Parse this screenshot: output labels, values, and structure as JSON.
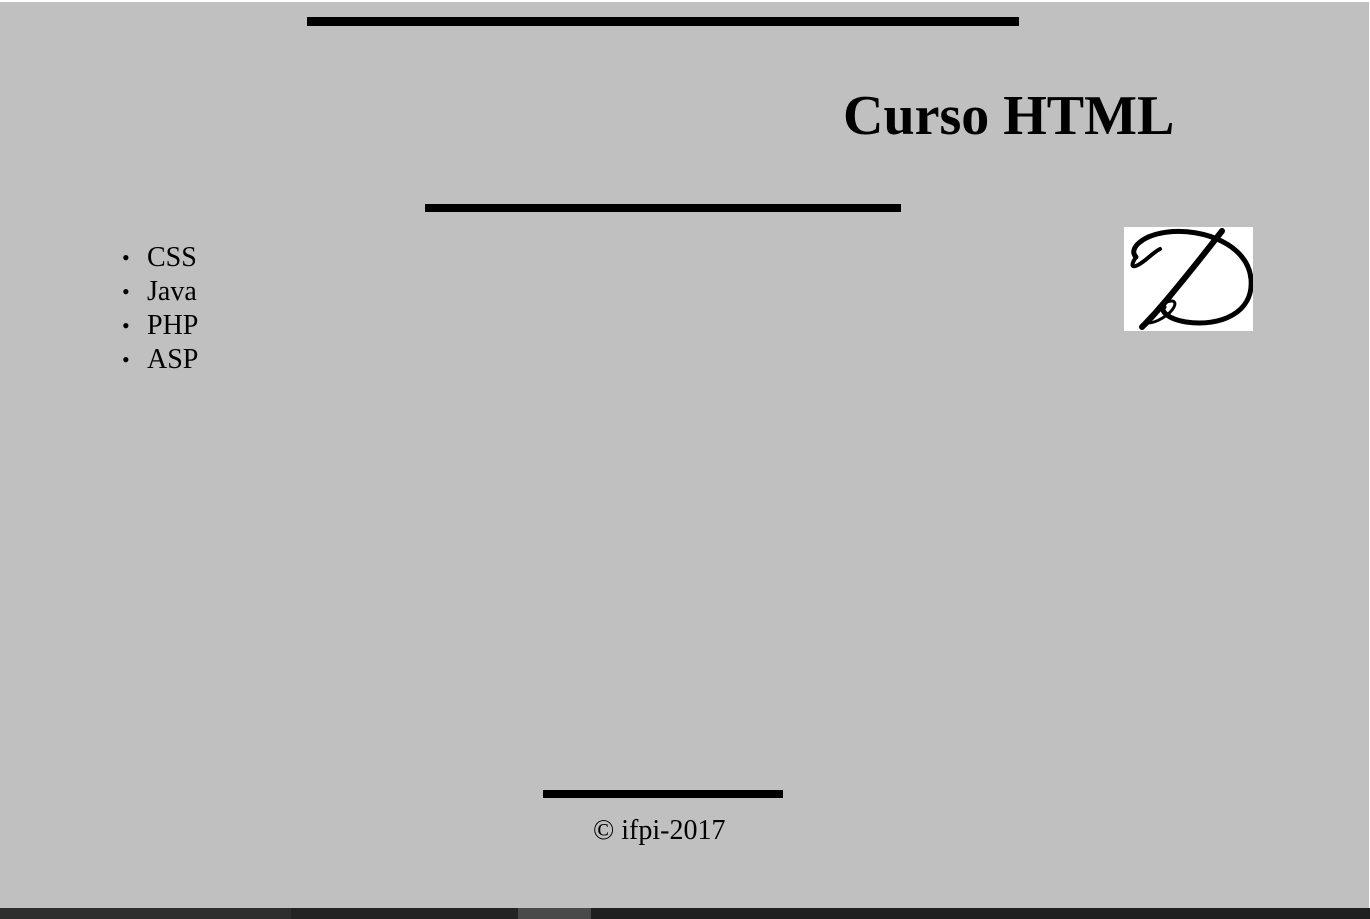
{
  "header": {
    "title": "Curso HTML"
  },
  "logo": {
    "icon": "script-d-logo-icon",
    "letter": "D"
  },
  "menu": {
    "bullet": "•",
    "items": [
      {
        "label": "CSS"
      },
      {
        "label": "Java"
      },
      {
        "label": "PHP"
      },
      {
        "label": "ASP"
      }
    ]
  },
  "footer": {
    "copyright": "© ifpi-2017"
  },
  "colors": {
    "page_background": "#c0c0c0",
    "rules": "#000000",
    "text": "#000000"
  }
}
